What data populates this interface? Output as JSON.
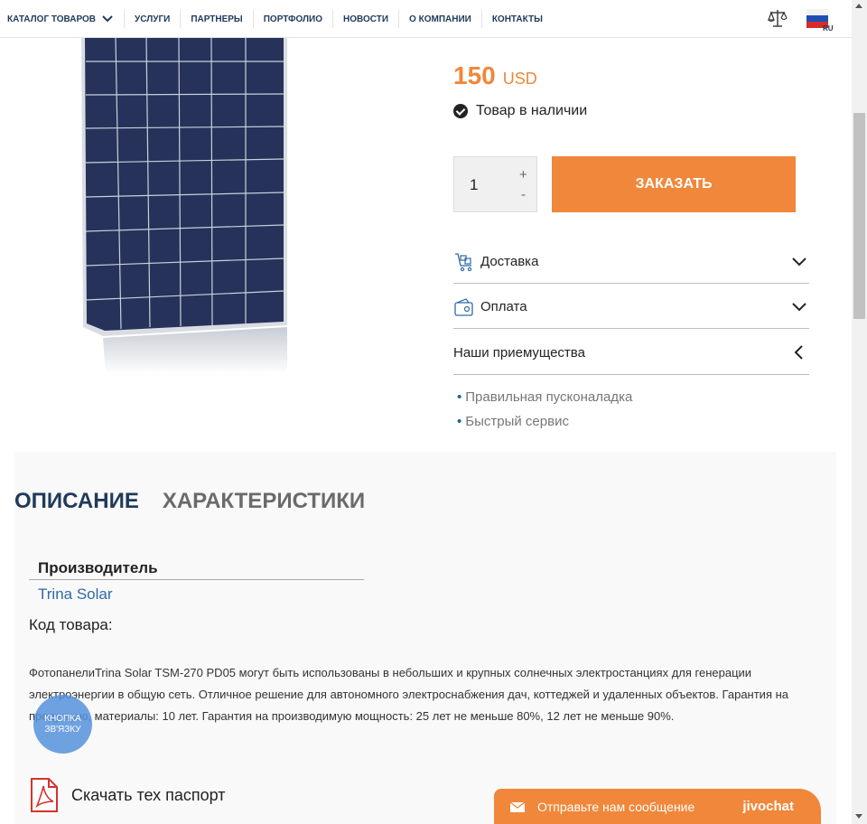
{
  "nav": {
    "items": [
      {
        "label": "КАТАЛОГ ТОВАРОВ"
      },
      {
        "label": "УСЛУГИ"
      },
      {
        "label": "ПАРТНЕРЫ"
      },
      {
        "label": "ПОРТФОЛИО"
      },
      {
        "label": "НОВОСТИ"
      },
      {
        "label": "О КОМПАНИИ"
      },
      {
        "label": "КОНТАКТЫ"
      }
    ],
    "lang": "RU"
  },
  "product": {
    "price": "150",
    "currency": "USD",
    "stock": "Товар в наличии",
    "quantity": "1",
    "qty_plus": "+",
    "qty_minus": "-",
    "order_label": "ЗАКАЗАТЬ",
    "accordion": [
      {
        "label": "Доставка"
      },
      {
        "label": "Оплата"
      },
      {
        "label": "Наши приемущества"
      }
    ],
    "advantages": [
      "Правильная пусконаладка",
      "Быстрый сервис"
    ]
  },
  "tabs": {
    "active": "ОПИСАНИЕ",
    "inactive": "ХАРАКТЕРИСТИКИ"
  },
  "description": {
    "maker_label": "Производитель",
    "maker_value": "Trina Solar",
    "code_label": "Код товара:",
    "text": "ФотопанелиTrina Solar TSM-270 PD05 могут быть использованы в небольших и крупных солнечных электростанциях для генерации электроэнергии в общую сеть. Отличное решение для автономного электроснабжения дач, коттеджей и удаленных объектов. Гарантия на продукцию, материалы: 10 лет. Гарантия на производимую мощность: 25 лет не меньше 80%, 12 лет не меньше 90%.",
    "download_label": "Скачать тех паспорт"
  },
  "callback": {
    "line1": "КНОПКА",
    "line2": "ЗВ'ЯЗКУ"
  },
  "chat": {
    "message": "Отправьте нам сообщение",
    "brand": "jivochat"
  },
  "colors": {
    "accent": "#f0873a",
    "navy": "#1f3a5a",
    "link": "#2f6aa6"
  }
}
